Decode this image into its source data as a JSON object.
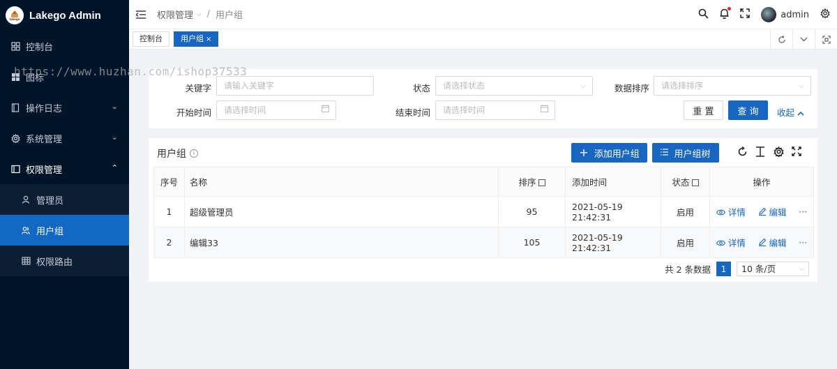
{
  "app": {
    "title": "Lakego Admin",
    "logo_text": "lakego"
  },
  "watermark": "https://www.huzhan.com/ishop37533",
  "sidebar": {
    "items": [
      {
        "label": "控制台",
        "icon": "dashboard-icon"
      },
      {
        "label": "图标",
        "icon": "grid-icon"
      },
      {
        "label": "操作日志",
        "icon": "file-icon",
        "arrow": "⌄"
      },
      {
        "label": "系统管理",
        "icon": "gear-icon",
        "arrow": "⌄"
      },
      {
        "label": "权限管理",
        "icon": "folder-icon",
        "arrow": "⌃"
      }
    ],
    "submenu": [
      {
        "label": "管理员",
        "icon": "user-icon"
      },
      {
        "label": "用户组",
        "icon": "users-icon",
        "active": true
      },
      {
        "label": "权限路由",
        "icon": "table-icon"
      }
    ]
  },
  "header": {
    "breadcrumb": {
      "parent": "权限管理",
      "current": "用户组"
    },
    "user": "admin"
  },
  "tabs": [
    {
      "label": "控制台",
      "active": false
    },
    {
      "label": "用户组",
      "active": true,
      "close": "×"
    }
  ],
  "search": {
    "keyword": {
      "label": "关键字",
      "placeholder": "请输入关键字"
    },
    "status": {
      "label": "状态",
      "placeholder": "请选择状态"
    },
    "sort": {
      "label": "数据排序",
      "placeholder": "请选择排序"
    },
    "start_time": {
      "label": "开始时间",
      "placeholder": "请选择时间"
    },
    "end_time": {
      "label": "结束时间",
      "placeholder": "请选择时间"
    },
    "reset_label": "重 置",
    "query_label": "查 询",
    "collapse_label": "收起"
  },
  "table_card": {
    "title": "用户组",
    "add_label": "添加用户组",
    "tree_label": "用户组树",
    "columns": [
      "序号",
      "名称",
      "排序",
      "添加时间",
      "状态",
      "操作"
    ],
    "rows": [
      {
        "index": "1",
        "name": "超级管理员",
        "sort": "95",
        "time": "2021-05-19 21:42:31",
        "status": "启用"
      },
      {
        "index": "2",
        "name": "编辑33",
        "sort": "105",
        "time": "2021-05-19 21:42:31",
        "status": "启用"
      }
    ],
    "action_detail": "详情",
    "action_edit": "编辑",
    "action_more": "···"
  },
  "pagination": {
    "total_text": "共 2 条数据",
    "current_page": "1",
    "page_size": "10 条/页"
  },
  "colors": {
    "sidebar_bg": "#001529",
    "primary": "#1766c2",
    "page_bg": "#f0f2f5"
  }
}
